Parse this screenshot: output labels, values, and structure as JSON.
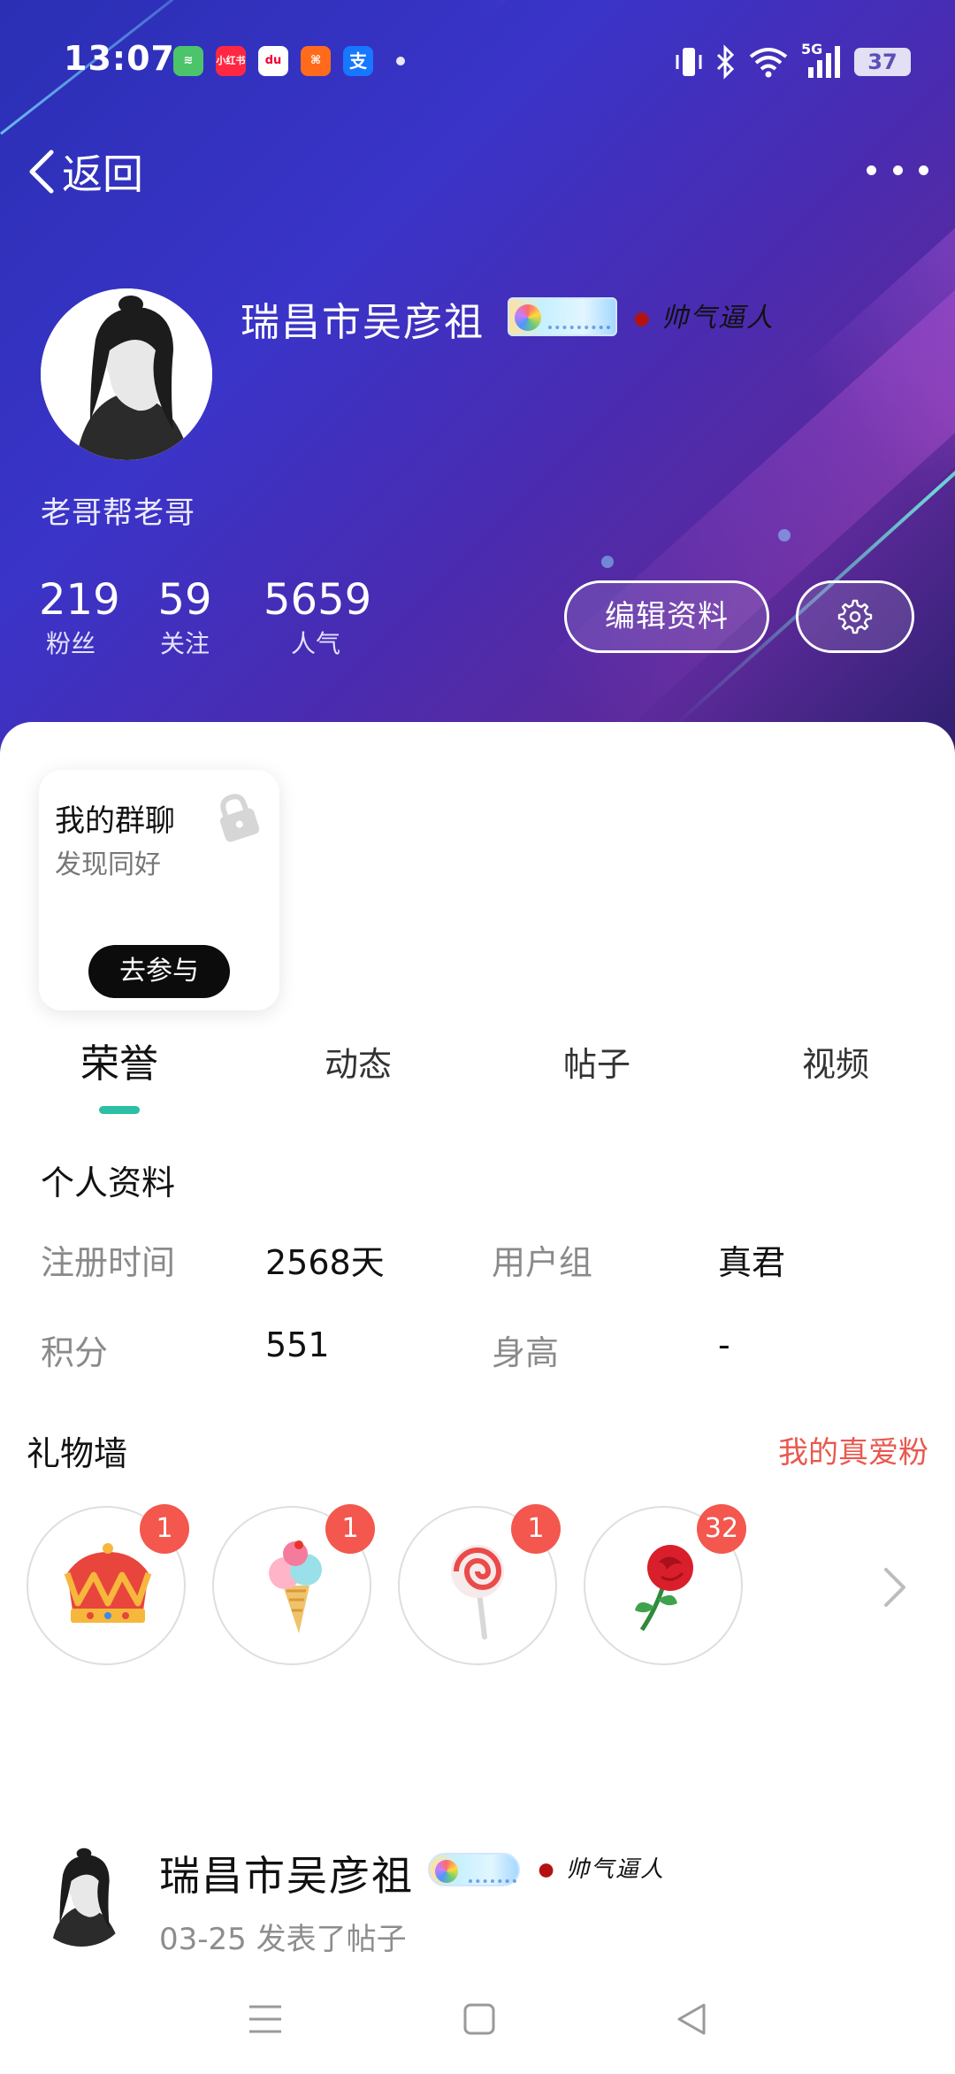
{
  "status_bar": {
    "time": "13:07",
    "apps": [
      {
        "icon": "wifi-app-icon",
        "label": "",
        "color": "#4cc46a"
      },
      {
        "icon": "xiaohongshu-icon",
        "label": "小红书",
        "color": "#ff2741"
      },
      {
        "icon": "baidu-map-icon",
        "label": "du",
        "color": "#ffffff"
      },
      {
        "icon": "meituan-icon",
        "label": "",
        "color": "#ff6b1a"
      },
      {
        "icon": "alipay-icon",
        "label": "支",
        "color": "#1677ff"
      }
    ],
    "network_label": "5G",
    "battery": "37"
  },
  "nav": {
    "back_label": "返回",
    "more_icon": "more-dots-icon"
  },
  "profile": {
    "username": "瑞昌市吴彦祖",
    "title_badge": "帅气逼人",
    "bio": "老哥帮老哥",
    "stats": [
      {
        "value": "219",
        "label": "粉丝"
      },
      {
        "value": "59",
        "label": "关注"
      },
      {
        "value": "5659",
        "label": "人气"
      }
    ],
    "edit_label": "编辑资料",
    "settings_icon": "gear-icon"
  },
  "group_card": {
    "title": "我的群聊",
    "subtitle": "发现同好",
    "button": "去参与"
  },
  "tabs": [
    "荣誉",
    "动态",
    "帖子",
    "视频"
  ],
  "active_tab": 0,
  "info": {
    "title": "个人资料",
    "rows": [
      {
        "label1": "注册时间",
        "value1": "2568天",
        "label2": "用户组",
        "value2": "真君"
      },
      {
        "label1": "积分",
        "value1": "551",
        "label2": "身高",
        "value2": "-"
      }
    ]
  },
  "gifts": {
    "title": "礼物墙",
    "link": "我的真爱粉",
    "items": [
      {
        "icon": "crown-icon",
        "count": "1"
      },
      {
        "icon": "ice-cream-icon",
        "count": "1"
      },
      {
        "icon": "lollipop-icon",
        "count": "1"
      },
      {
        "icon": "rose-icon",
        "count": "32"
      }
    ]
  },
  "post": {
    "author": "瑞昌市吴彦祖",
    "title_badge": "帅气逼人",
    "date": "03-25",
    "action": "发表了帖子"
  },
  "colors": {
    "accent": "#2bc0a3",
    "link": "#e9584f",
    "badge": "#f3574d"
  }
}
